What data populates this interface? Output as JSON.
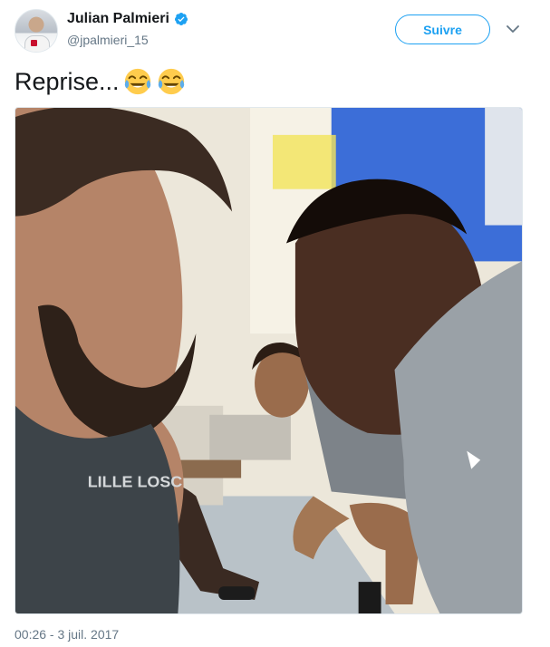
{
  "tweet": {
    "display_name": "Julian Palmieri",
    "handle": "@jpalmieri_15",
    "text": "Reprise...",
    "emojis": [
      "face-with-tears-of-joy",
      "face-with-tears-of-joy"
    ],
    "timestamp": "00:26 - 3 juil. 2017"
  },
  "actions": {
    "follow_label": "Suivre"
  },
  "photo": {
    "shirt_brand_text": "LILLE LOSC"
  },
  "colors": {
    "accent": "#1da1f2",
    "text_primary": "#14171a",
    "text_secondary": "#657786"
  }
}
